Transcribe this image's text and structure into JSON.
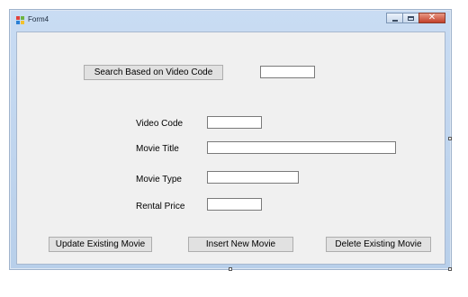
{
  "window": {
    "title": "Form4",
    "close_glyph": "✕"
  },
  "form": {
    "search_button": "Search Based on Video Code",
    "search_value": "",
    "fields": {
      "video_code_label": "Video Code",
      "video_code_value": "",
      "movie_title_label": "Movie Title",
      "movie_title_value": "",
      "movie_type_label": "Movie Type",
      "movie_type_value": "",
      "rental_price_label": "Rental Price",
      "rental_price_value": ""
    },
    "buttons": {
      "update": "Update Existing Movie",
      "insert": "Insert New Movie",
      "delete": "Delete Existing Movie"
    }
  }
}
